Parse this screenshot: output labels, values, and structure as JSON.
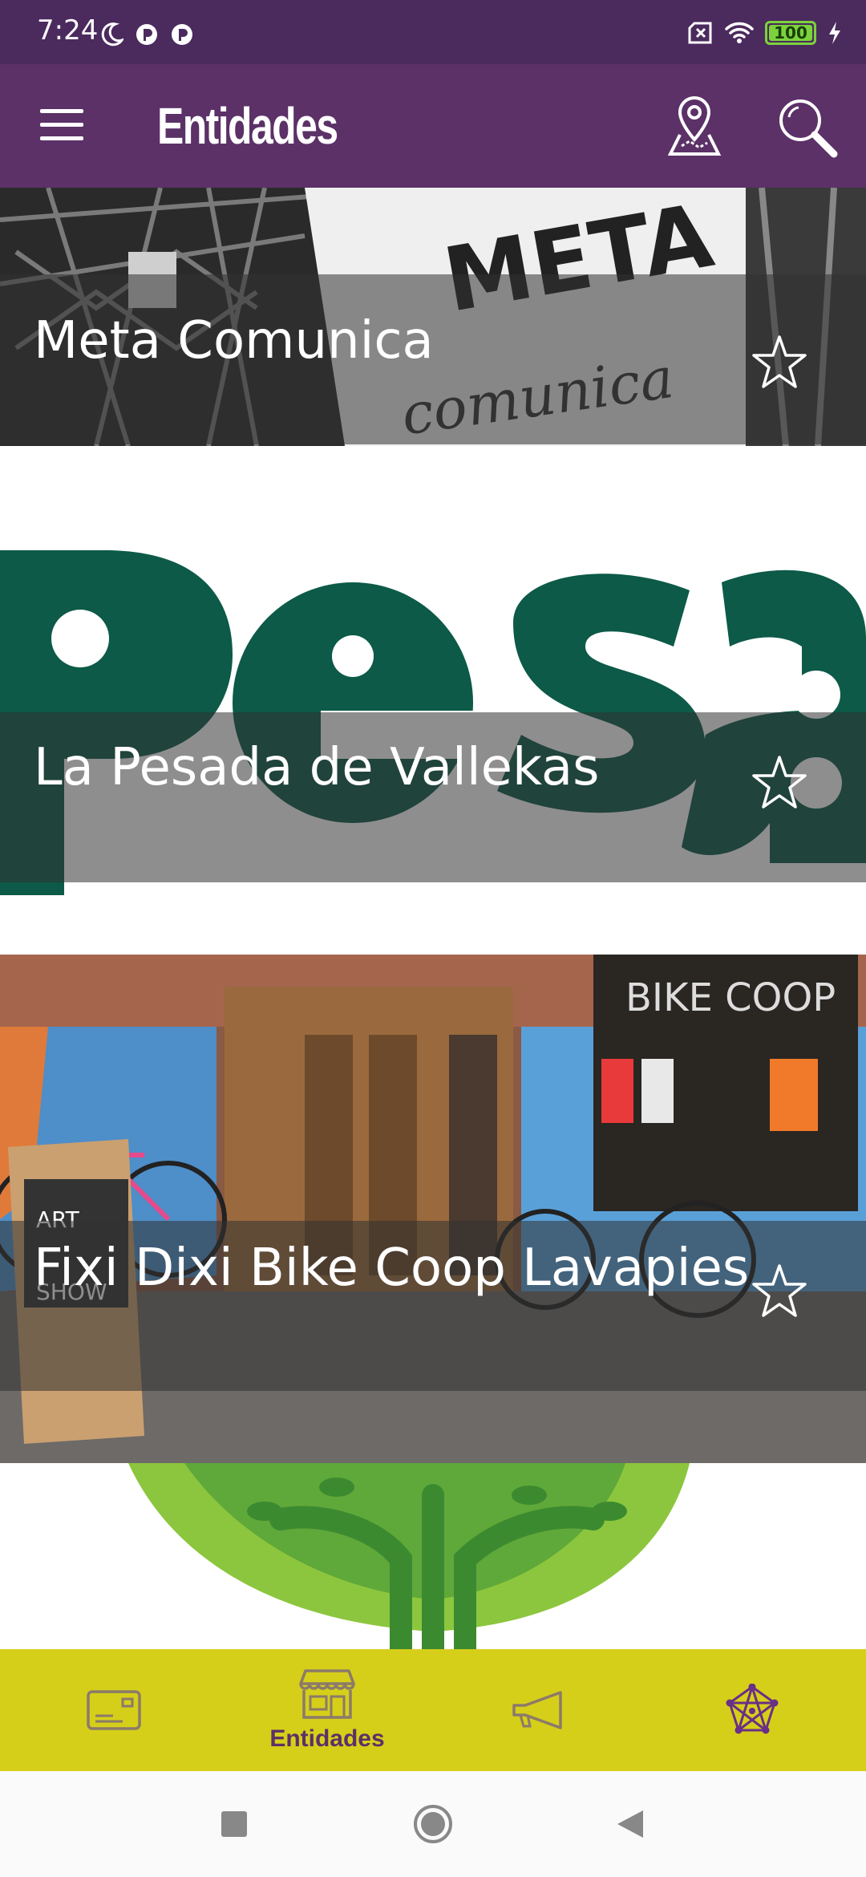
{
  "status_bar": {
    "time": "7:24",
    "battery": "100"
  },
  "app_bar": {
    "title": "Entidades",
    "menu_icon": "hamburger-menu-icon",
    "map_icon": "map-pin-icon",
    "search_icon": "search-icon"
  },
  "entities": [
    {
      "name": "Meta Comunica",
      "favorite": false,
      "image_text": "META comunica"
    },
    {
      "name": "La Pesada de Vallekas",
      "favorite": false,
      "image_text": "Pesa"
    },
    {
      "name": "Fixi Dixi Bike Coop Lavapies",
      "favorite": false,
      "image_text": "BIKE COOP"
    },
    {
      "name": "",
      "favorite": false
    }
  ],
  "bottom_nav": {
    "items": [
      {
        "icon": "card-icon",
        "label": ""
      },
      {
        "icon": "storefront-icon",
        "label": "Entidades",
        "active": true
      },
      {
        "icon": "megaphone-icon",
        "label": ""
      },
      {
        "icon": "network-icon",
        "label": ""
      }
    ]
  },
  "colors": {
    "status_bar": "#4b2a5e",
    "app_bar": "#5b3168",
    "bottom_nav": "#d6cf19",
    "accent": "#5b3168"
  }
}
